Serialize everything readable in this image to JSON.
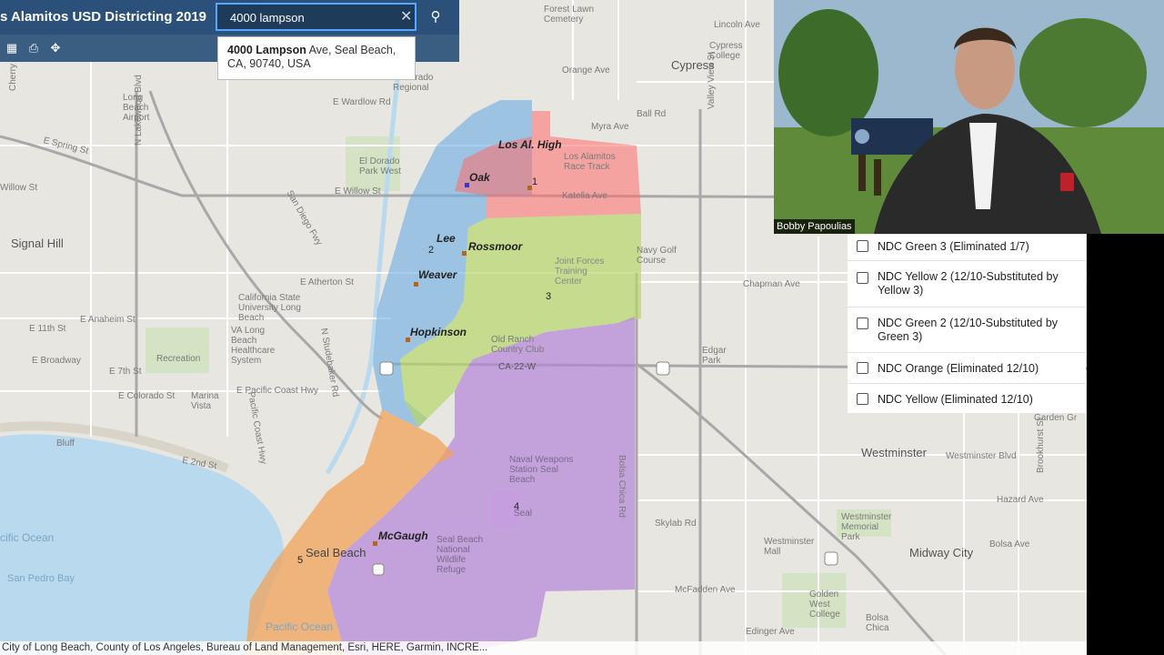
{
  "app": {
    "title": "s Alamitos USD Districting 2019"
  },
  "search": {
    "value": "4000 lampson",
    "suggestion_bold": "4000 Lampson",
    "suggestion_rest": " Ave, Seal Beach, CA, 90740, USA"
  },
  "toolbar": {
    "icons": [
      "grid-icon",
      "print-icon",
      "move-icon"
    ]
  },
  "video": {
    "participant": "Bobby Papoulias"
  },
  "layers": [
    {
      "label": "NDC Green 3 (Eliminated 1/7)",
      "checked": false
    },
    {
      "label": "NDC Yellow 2 (12/10-Substituted by Yellow 3)",
      "checked": false
    },
    {
      "label": "NDC Green 2 (12/10-Substituted by Green 3)",
      "checked": false
    },
    {
      "label": "NDC Orange (Eliminated 12/10)",
      "checked": false
    },
    {
      "label": "NDC Yellow (Eliminated 12/10)",
      "checked": false
    }
  ],
  "attribution": "City of Long Beach, County of Los Angeles, Bureau of Land Management, Esri, HERE, Garmin, INCRE...",
  "map": {
    "districts": [
      "1",
      "2",
      "3",
      "4",
      "5"
    ],
    "schools": [
      "Los Al. High",
      "Oak",
      "Lee",
      "Rossmoor",
      "Weaver",
      "Hopkinson",
      "McGaugh"
    ],
    "places": [
      "Signal Hill",
      "Seal Beach",
      "Cypress",
      "Westminster",
      "Midway City",
      "Pacific Ocean",
      "San Pedro Bay",
      "Long Beach Airport",
      "California State University Long Beach",
      "Los Alamitos Race Track",
      "Joint Forces Training Center",
      "Naval Weapons Station Seal Beach",
      "Old Ranch Country Club",
      "Seal Beach National Wildlife Refuge",
      "VA Long Beach Healthcare System",
      "Navy Golf Course",
      "Golden West College",
      "Westminster Mall",
      "Westminster Memorial Park",
      "Recreation",
      "Marina Vista",
      "El Dorado Park West",
      "Cypress College",
      "Forest Lawn Cemetery",
      "Edgar Park",
      "Bolsa Chica",
      "El Dorado Regional",
      "Bluff",
      "Los Alamitos"
    ],
    "streets": [
      "E Spring St",
      "E Willow St",
      "E Atherton St",
      "E Anaheim St",
      "E 11th St",
      "E 7th St",
      "E Colorado St",
      "E Wardlow Rd",
      "E 2nd St",
      "CA-22-W",
      "Katella Ave",
      "Lincoln Ave",
      "Orange Ave",
      "Ball Rd",
      "Myra Ave",
      "Chapman Ave",
      "Westminster Blvd",
      "Bolsa Ave",
      "McFadden Ave",
      "Edinger Ave",
      "Hazard Ave",
      "Garden Gr",
      "Skylab Rd",
      "Bolsa Chica Rd",
      "Valley View St",
      "Pacific Coast Hwy",
      "E Pacific Coast Hwy",
      "San Diego Fwy",
      "N Lakewood Blvd",
      "N Studebaker Rd",
      "Brookhurst St",
      "E Broadway",
      "Willow St",
      "Cherry Ave"
    ]
  }
}
